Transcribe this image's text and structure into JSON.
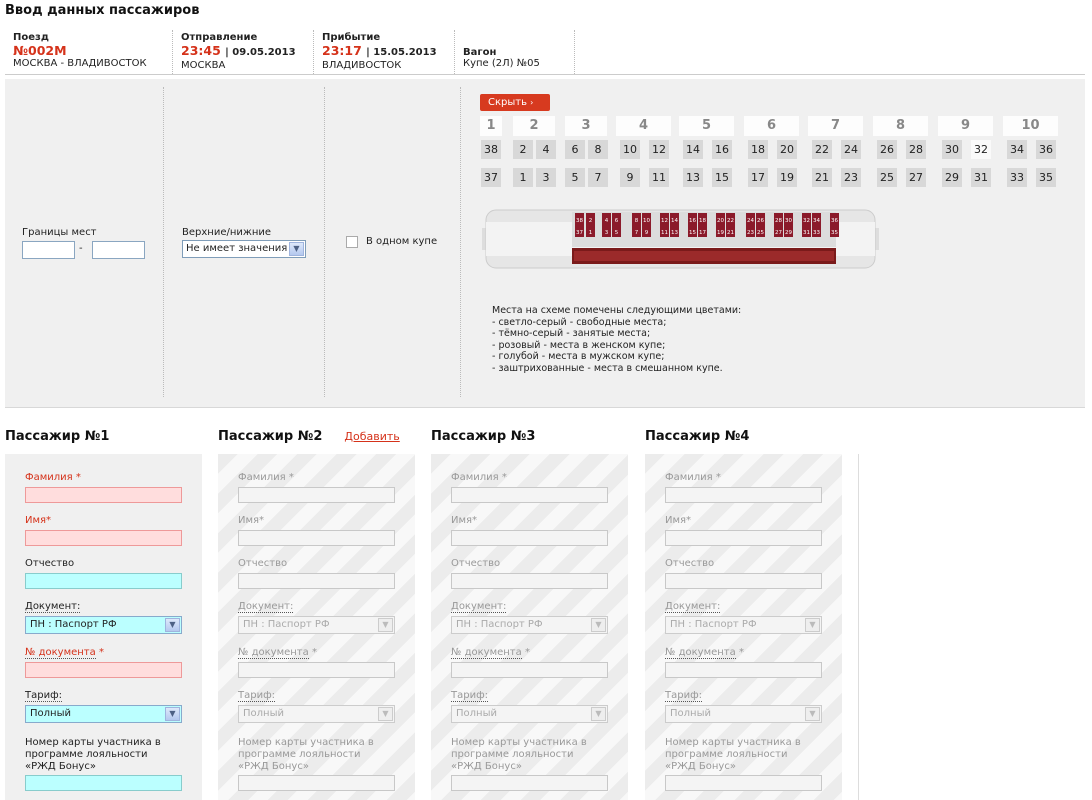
{
  "page_title": "Ввод данных пассажиров",
  "ticket": {
    "train": {
      "label": "Поезд",
      "number": "№002М",
      "route": "МОСКВА - ВЛАДИВОСТОК"
    },
    "departure": {
      "label": "Отправление",
      "time": "23:45",
      "date": "| 09.05.2013",
      "station": "МОСКВА"
    },
    "arrival": {
      "label": "Прибытие",
      "time": "23:17",
      "date": "| 15.05.2013",
      "station": "ВЛАДИВОСТОК"
    },
    "car": {
      "label": "Вагон",
      "value": "Купе (2Л) №05"
    }
  },
  "filters": {
    "seat_range_label": "Границы мест",
    "seat_range_dash": "-",
    "upper_lower_label": "Верхние/нижние",
    "upper_lower_value": "Не имеет значения",
    "same_compartment_label": "В одном купе",
    "hide_button": "Скрыть"
  },
  "compartments": [
    {
      "n": "1",
      "top": [
        "38"
      ],
      "bottom": [
        "37"
      ]
    },
    {
      "n": "2",
      "top": [
        "2",
        "4"
      ],
      "bottom": [
        "1",
        "3"
      ]
    },
    {
      "n": "3",
      "top": [
        "6",
        "8"
      ],
      "bottom": [
        "5",
        "7"
      ]
    },
    {
      "n": "4",
      "top": [
        "10",
        "12"
      ],
      "bottom": [
        "9",
        "11"
      ]
    },
    {
      "n": "5",
      "top": [
        "14",
        "16"
      ],
      "bottom": [
        "13",
        "15"
      ]
    },
    {
      "n": "6",
      "top": [
        "18",
        "20"
      ],
      "bottom": [
        "17",
        "19"
      ]
    },
    {
      "n": "7",
      "top": [
        "22",
        "24"
      ],
      "bottom": [
        "21",
        "23"
      ]
    },
    {
      "n": "8",
      "top": [
        "26",
        "28"
      ],
      "bottom": [
        "25",
        "27"
      ]
    },
    {
      "n": "9",
      "top": [
        "30",
        "32"
      ],
      "bottom": [
        "29",
        "31"
      ]
    },
    {
      "n": "10",
      "top": [
        "34",
        "36"
      ],
      "bottom": [
        "33",
        "35"
      ]
    }
  ],
  "free_seats": [
    "32"
  ],
  "car_scheme_top": [
    "38",
    "2",
    "4",
    "6",
    "8",
    "10",
    "12",
    "14",
    "16",
    "18",
    "20",
    "22",
    "24",
    "26",
    "28",
    "30",
    "32",
    "34",
    "36"
  ],
  "car_scheme_bottom": [
    "37",
    "1",
    "3",
    "5",
    "7",
    "9",
    "11",
    "13",
    "15",
    "17",
    "19",
    "21",
    "23",
    "25",
    "27",
    "29",
    "31",
    "33",
    "35"
  ],
  "legend": [
    "Места на схеме помечены следующими цветами:",
    "- светло-серый - свободные места;",
    "- тёмно-серый - занятые места;",
    "- розовый - места в женском купе;",
    "- голубой - места в мужском купе;",
    "- заштрихованные - места в смешанном купе."
  ],
  "passengers": [
    {
      "title": "Пассажир №1",
      "add": ""
    },
    {
      "title": "Пассажир №2",
      "add": "Добавить"
    },
    {
      "title": "Пассажир №3",
      "add": ""
    },
    {
      "title": "Пассажир №4",
      "add": ""
    }
  ],
  "form": {
    "surname": "Фамилия",
    "name": "Имя",
    "patronymic": "Отчество",
    "document": "Документ:",
    "document_value": "ПН : Паспорт РФ",
    "doc_number": "№ документа",
    "tariff": "Тариф:",
    "tariff_value": "Полный",
    "loyalty_1": "Номер карты участника в",
    "loyalty_2": "программе лояльности",
    "loyalty_3": "«РЖД Бонус»",
    "asterisk": "*"
  },
  "colors": {
    "accent": "#d5321a",
    "occupied": "#d8d8d8",
    "male": "#bbffff",
    "female": "#ffdddd",
    "seat_scheme": "#8b1a2a"
  }
}
